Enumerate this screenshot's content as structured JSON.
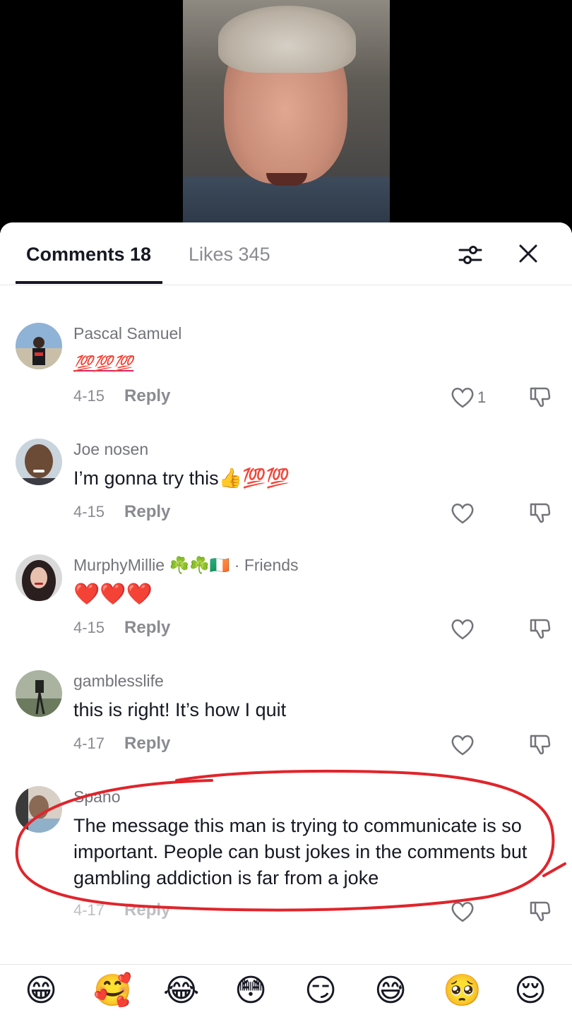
{
  "header": {
    "comments_tab": "Comments 18",
    "likes_tab": "Likes 345"
  },
  "icons": {
    "filter": "sliders-icon",
    "close": "close-icon",
    "like": "heart-outline-icon",
    "dislike": "thumbs-down-icon"
  },
  "comments": [
    {
      "username": "Pascal Samuel",
      "text": "💯💯💯",
      "date": "4-15",
      "reply": "Reply",
      "likes": "1",
      "avatar_color": "#3a6ea5"
    },
    {
      "username": "Joe nosen",
      "text": "I’m gonna try this👍💯💯",
      "date": "4-15",
      "reply": "Reply",
      "likes": "",
      "avatar_color": "#6b4a36"
    },
    {
      "username": "MurphyMillie ☘️☘️🇮🇪",
      "friends": " · Friends",
      "text": "❤️❤️❤️",
      "date": "4-15",
      "reply": "Reply",
      "likes": "",
      "avatar_color": "#3b2a2a"
    },
    {
      "username": "gamblesslife",
      "text": "this is right! It’s how I quit",
      "date": "4-17",
      "reply": "Reply",
      "likes": "",
      "avatar_color": "#5b6b52"
    },
    {
      "username": "Spano",
      "text": "The message this man is trying to communicate is so important. People can bust jokes in the comments but gambling addiction is far from a joke",
      "date": "4-17",
      "reply": "Reply",
      "likes": "",
      "avatar_color": "#8a6a55"
    }
  ],
  "emoji_bar": [
    "😁",
    "🥰",
    "😂",
    "😳",
    "😏",
    "😅",
    "🥺",
    "😌"
  ],
  "annotation_color": "#e0242b"
}
